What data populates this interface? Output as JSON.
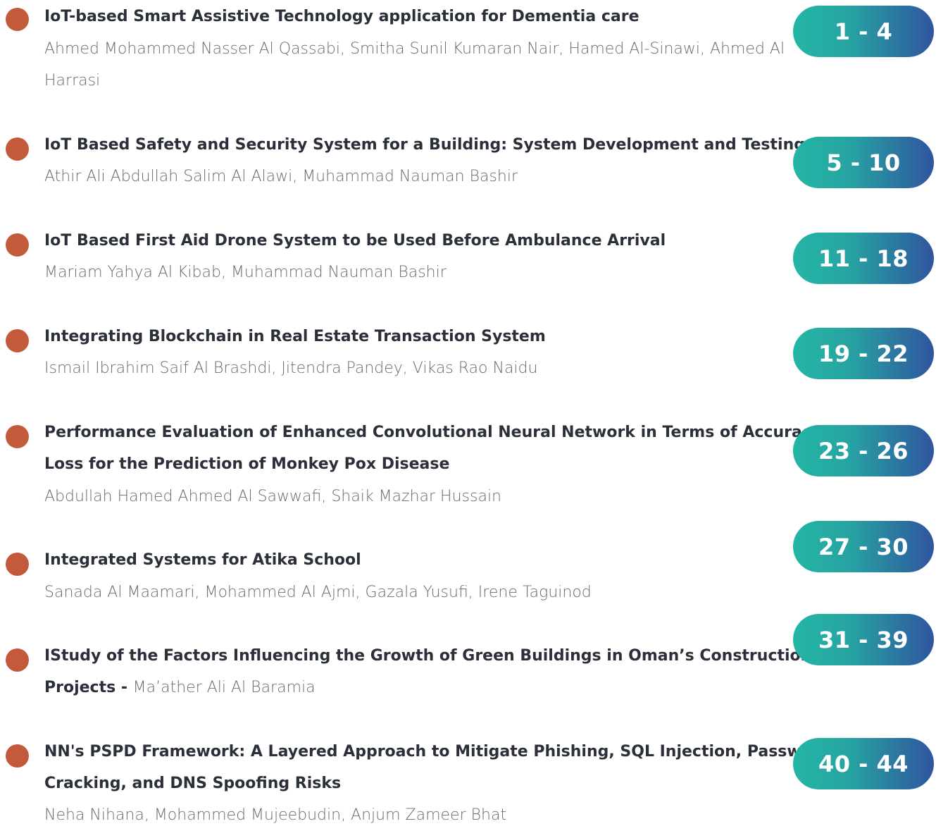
{
  "entries": [
    {
      "title": "IoT-based Smart Assistive Technology application for Dementia care",
      "authors_line1": "Ahmed Mohammed Nasser Al Qassabi, Smitha Sunil Kumaran Nair, Hamed Al-Sinawi, Ahmed Al",
      "authors_line2": "Harrasi",
      "pages": "1 - 4"
    },
    {
      "title": "IoT Based Safety and Security System for a Building: System Development and Testing",
      "authors": "Athir Ali Abdullah Salim Al Alawi, Muhammad Nauman Bashir",
      "pages": "5 - 10"
    },
    {
      "title": "IoT Based First Aid Drone System to be Used Before Ambulance Arrival",
      "authors": "Mariam Yahya Al Kibab, Muhammad Nauman Bashir",
      "pages": "11 - 18"
    },
    {
      "title": "Integrating Blockchain in Real Estate Transaction System",
      "authors": "Ismail Ibrahim Saif Al Brashdi, Jitendra Pandey, Vikas Rao Naidu",
      "pages": "19 - 22"
    },
    {
      "title_line1": "Performance Evaluation of Enhanced Convolutional Neural Network in Terms of Accuracy and",
      "title_line2": "Loss for the Prediction of Monkey Pox Disease",
      "authors": "Abdullah Hamed Ahmed Al Sawwafi, Shaik Mazhar Hussain",
      "pages": "23 - 26"
    },
    {
      "title": "Integrated Systems for Atika School",
      "authors": "Sanada Al Maamari, Mohammed Al Ajmi, Gazala Yusufi, Irene Taguinod",
      "pages": "27 - 30"
    },
    {
      "title_line1": "IStudy of the Factors Influencing the Growth of Green Buildings in Oman’s Construction",
      "title_line2": "Projects - ",
      "authors": "Ma’ather Ali Al Baramia",
      "pages": "31 - 39"
    },
    {
      "title_line1": "NN's PSPD Framework: A Layered Approach to Mitigate Phishing, SQL Injection, Password",
      "title_line2": "Cracking, and DNS Spoofing Risks",
      "authors": "Neha Nihana, Mohammed Mujeebudin, Anjum Zameer Bhat",
      "pages": "40 - 44"
    }
  ],
  "colors": {
    "bullet": "#c45a3c",
    "title_text": "#2a2f3a",
    "author_text": "#666b73",
    "badge_gradient_start": "#24b6a5",
    "badge_gradient_end": "#2f559f"
  }
}
